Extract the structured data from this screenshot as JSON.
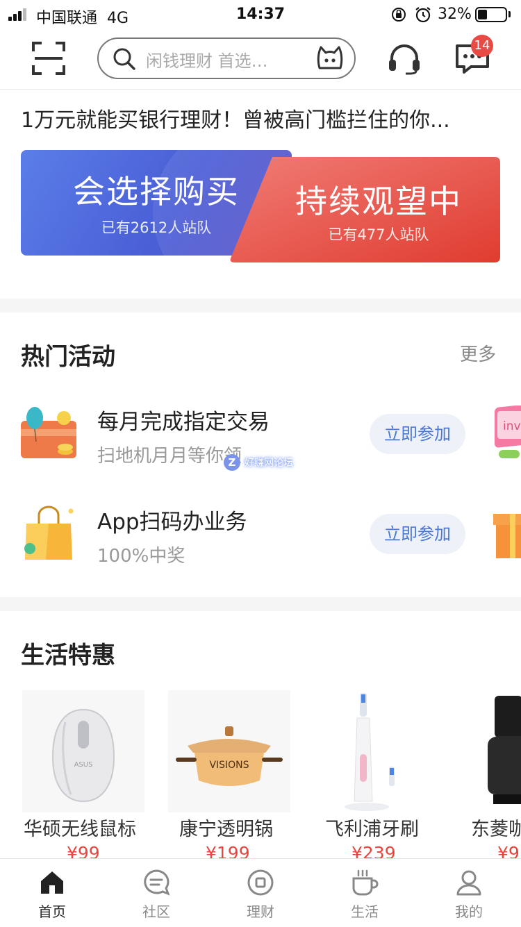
{
  "status_bar": {
    "carrier": "中国联通",
    "network": "4G",
    "time": "14:37",
    "battery": "32%",
    "battery_level": 0.32
  },
  "header": {
    "search_placeholder": "闲钱理财 首选…",
    "message_badge": "14",
    "icons": [
      "scan-icon",
      "search-icon",
      "mascot-icon",
      "headset-icon",
      "message-icon"
    ]
  },
  "headline": "1万元就能买银行理财！曾被高门槛拦住的你...",
  "vote": {
    "left": {
      "title": "会选择购买",
      "count": "已有2612人站队",
      "color": "#4a5fd6"
    },
    "right": {
      "title": "持续观望中",
      "count": "已有477人站队",
      "color": "#e2453a"
    }
  },
  "hot_activities": {
    "title": "热门活动",
    "more": "更多",
    "items": [
      {
        "title": "每月完成指定交易",
        "subtitle": "扫地机月月等你领",
        "button": "立即参加"
      },
      {
        "title": "App扫码办业务",
        "subtitle": "100%中奖",
        "button": "立即参加"
      }
    ],
    "peek_text": "inv"
  },
  "watermark": {
    "badge": "Z",
    "text": "好赚网论坛"
  },
  "life_deals": {
    "title": "生活特惠",
    "products": [
      {
        "name": "华硕无线鼠标",
        "price": "¥99",
        "brand_text": "ASUS"
      },
      {
        "name": "康宁透明锅",
        "price": "¥199",
        "brand_text": "VISIONS"
      },
      {
        "name": "飞利浦牙刷",
        "price": "¥239"
      },
      {
        "name": "东菱咖",
        "price": "¥9"
      }
    ]
  },
  "tabbar": {
    "items": [
      {
        "label": "首页",
        "active": true
      },
      {
        "label": "社区",
        "active": false
      },
      {
        "label": "理财",
        "active": false
      },
      {
        "label": "生活",
        "active": false
      },
      {
        "label": "我的",
        "active": false
      }
    ]
  }
}
